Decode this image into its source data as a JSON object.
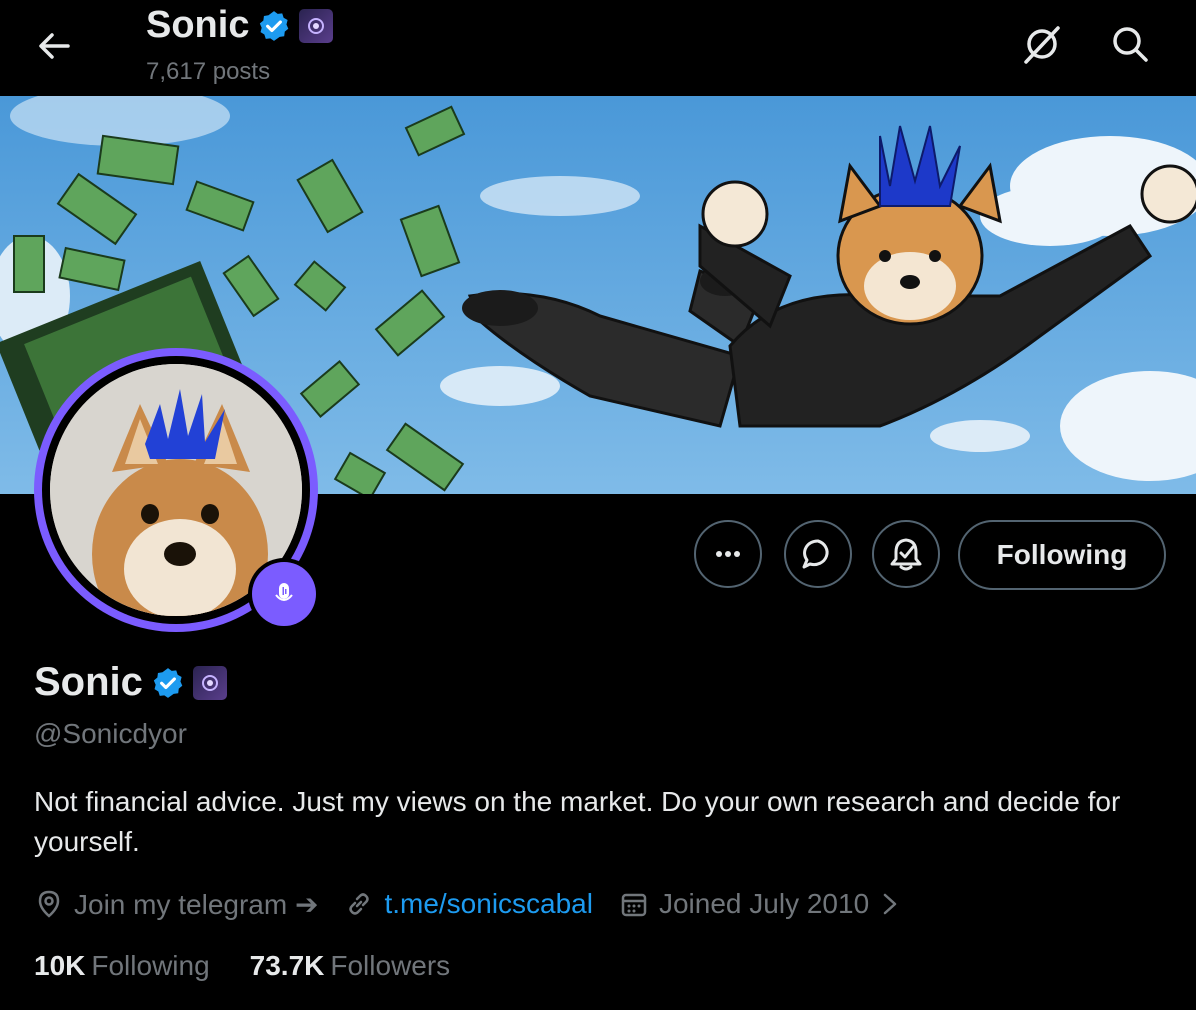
{
  "header": {
    "name": "Sonic",
    "posts": "7,617 posts"
  },
  "actions": {
    "following_label": "Following"
  },
  "profile": {
    "name": "Sonic",
    "handle": "@Sonicdyor",
    "bio": "Not financial advice. Just my views on the market. Do your own research and decide for yourself.",
    "location": "Join my telegram ➔",
    "link": "t.me/sonicscabal",
    "joined": "Joined July 2010"
  },
  "stats": {
    "following_count": "10K",
    "following_label": "Following",
    "followers_count": "73.7K",
    "followers_label": "Followers"
  },
  "colors": {
    "background": "#000000",
    "accent": "#1d9bf0",
    "verified": "#1d9bf0",
    "avatar_ring": "#7b5cff",
    "muted_text": "#71767b"
  },
  "icons": [
    "back-arrow-icon",
    "verified-badge-icon",
    "affiliate-badge-icon",
    "grok-icon",
    "search-icon",
    "more-icon",
    "message-icon",
    "notification-bell-icon",
    "spaces-mic-icon",
    "location-pin-icon",
    "link-icon",
    "calendar-icon",
    "chevron-right-icon"
  ]
}
